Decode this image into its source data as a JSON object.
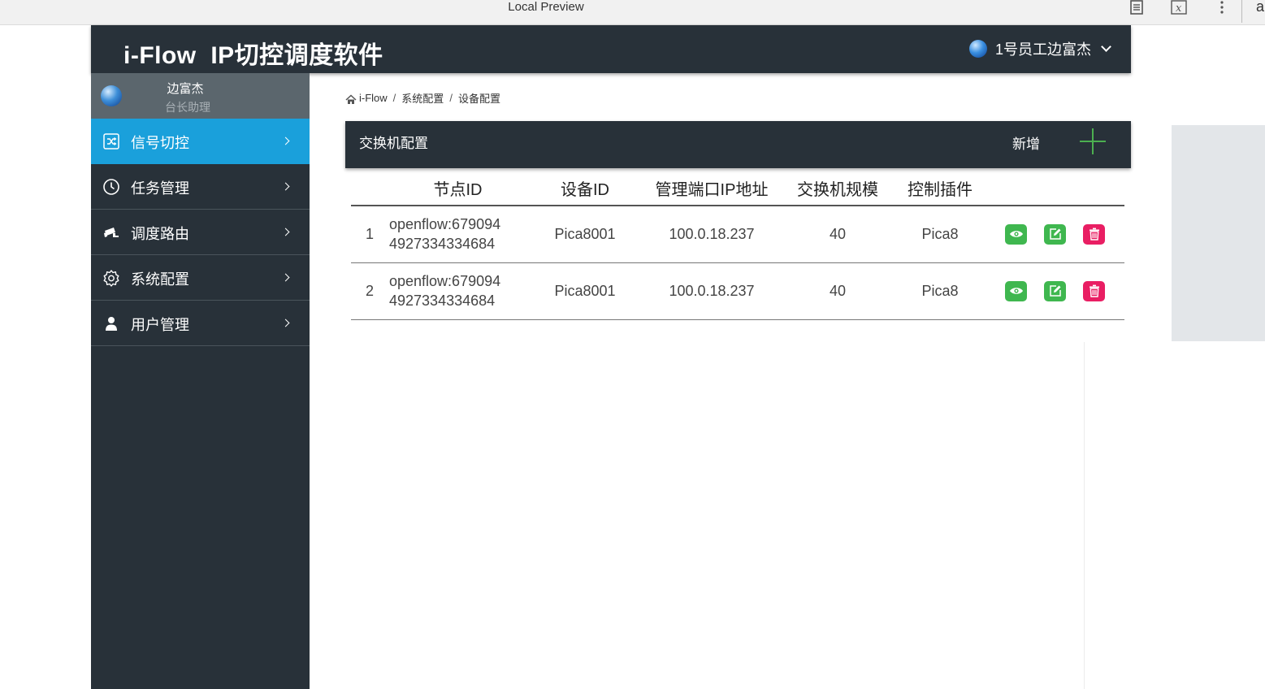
{
  "browser": {
    "title": "Local Preview",
    "icons": [
      "reader-icon",
      "formula-icon",
      "more-icon"
    ],
    "edge_char": "a"
  },
  "header": {
    "app_title": "i-Flow  IP切控调度软件",
    "user": "1号员工边富杰"
  },
  "sidebar": {
    "profile": {
      "name": "边富杰",
      "role": "台长助理"
    },
    "items": [
      {
        "label": "信号切控",
        "icon": "shuffle-icon",
        "active": true
      },
      {
        "label": "任务管理",
        "icon": "clock-icon",
        "active": false
      },
      {
        "label": "调度路由",
        "icon": "camera-icon",
        "active": false
      },
      {
        "label": "系统配置",
        "icon": "gear-icon",
        "active": false
      },
      {
        "label": "用户管理",
        "icon": "user-icon",
        "active": false
      }
    ]
  },
  "breadcrumb": [
    "i-Flow",
    "系统配置",
    "设备配置"
  ],
  "card": {
    "title": "交换机配置",
    "add_label": "新增"
  },
  "table": {
    "columns": [
      "",
      "节点ID",
      "设备ID",
      "管理端口IP地址",
      "交换机规模",
      "控制插件",
      ""
    ],
    "rows": [
      {
        "index": "1",
        "node_line1": "openflow:679094",
        "node_line2": "4927334334684",
        "device": "Pica8001",
        "ip": "100.0.18.237",
        "scale": "40",
        "plugin": "Pica8"
      },
      {
        "index": "2",
        "node_line1": "openflow:679094",
        "node_line2": "4927334334684",
        "device": "Pica8001",
        "ip": "100.0.18.237",
        "scale": "40",
        "plugin": "Pica8"
      }
    ]
  },
  "colors": {
    "dark": "#283139",
    "active": "#1aa0db",
    "green": "#3fb74f",
    "red": "#e91e63",
    "add": "#4caf50"
  }
}
